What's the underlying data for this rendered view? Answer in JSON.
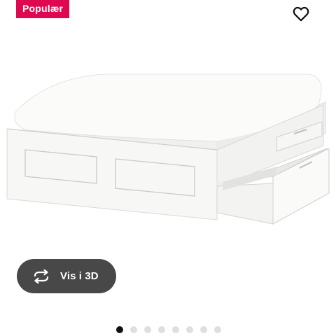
{
  "badge": {
    "label": "Populær",
    "color": "#e00751"
  },
  "favorite": {
    "icon": "heart-outline-icon"
  },
  "product_image": {
    "subject": "bed-frame-with-storage-drawers",
    "color": "#ffffff"
  },
  "view_3d": {
    "label": "Vis i 3D",
    "icon": "rotate-arrows-icon",
    "background": "#484848"
  },
  "carousel": {
    "total": 8,
    "active_index": 0
  }
}
